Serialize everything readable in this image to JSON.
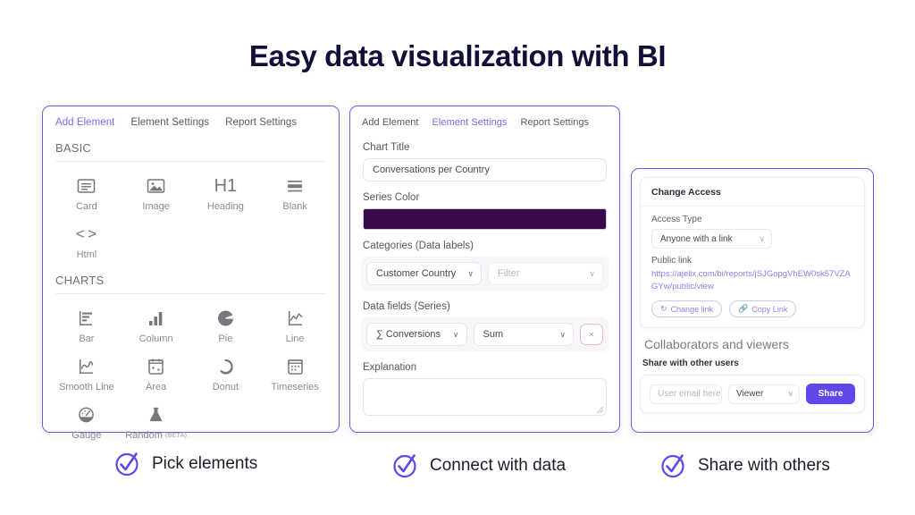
{
  "title": "Easy data visualization with BI",
  "theme": {
    "accent": "#6048e8",
    "panel_border": "#6c5ce0",
    "tab_active": "#7b68ee",
    "link": "#8b7fe8",
    "series_color": "#3a0a4a",
    "title_color": "#101138"
  },
  "panel_add_element": {
    "tabs": [
      {
        "label": "Add Element",
        "active": true
      },
      {
        "label": "Element Settings",
        "active": false
      },
      {
        "label": "Report Settings",
        "active": false
      }
    ],
    "sections": [
      {
        "heading": "BASIC",
        "items": [
          {
            "label": "Card",
            "icon": "card-icon"
          },
          {
            "label": "Image",
            "icon": "image-icon"
          },
          {
            "label": "Heading",
            "icon": "h1-icon"
          },
          {
            "label": "Blank",
            "icon": "blank-icon"
          },
          {
            "label": "Html",
            "icon": "code-icon"
          }
        ]
      },
      {
        "heading": "CHARTS",
        "items": [
          {
            "label": "Bar",
            "icon": "bar-chart-icon"
          },
          {
            "label": "Column",
            "icon": "column-chart-icon"
          },
          {
            "label": "Pie",
            "icon": "pie-chart-icon"
          },
          {
            "label": "Line",
            "icon": "line-chart-icon"
          },
          {
            "label": "Smooth Line",
            "icon": "smooth-line-chart-icon"
          },
          {
            "label": "Area",
            "icon": "area-chart-icon"
          },
          {
            "label": "Donut",
            "icon": "donut-chart-icon"
          },
          {
            "label": "Timeseries",
            "icon": "timeseries-chart-icon"
          },
          {
            "label": "Gauge",
            "icon": "gauge-chart-icon"
          },
          {
            "label": "Random",
            "badge": "(BETA)",
            "icon": "flask-icon"
          }
        ]
      }
    ]
  },
  "panel_element_settings": {
    "tabs": [
      {
        "label": "Add Element",
        "active": false
      },
      {
        "label": "Element Settings",
        "active": true
      },
      {
        "label": "Report Settings",
        "active": false
      }
    ],
    "chart_title": {
      "label": "Chart Title",
      "value": "Conversations per Country"
    },
    "series_color": {
      "label": "Series Color",
      "value": "#3a0a4a"
    },
    "categories": {
      "label": "Categories (Data labels)",
      "field_value": "Customer Country",
      "filter_placeholder": "Filter"
    },
    "data_fields": {
      "label": "Data fields (Series)",
      "series_value": "Conversions",
      "series_prefix": "∑",
      "aggregation_value": "Sum",
      "remove_label": "×"
    },
    "explanation": {
      "label": "Explanation",
      "value": ""
    }
  },
  "panel_share": {
    "change_access": {
      "card_title": "Change Access",
      "access_type_label": "Access Type",
      "access_type_value": "Anyone with a link",
      "public_link_label": "Public link",
      "public_link_url": "https://ajelix.com/bi/reports/jSJGopgVhEW0sk57VZAGYw/public/view",
      "change_link_button": "Change link",
      "copy_link_button": "Copy Link"
    },
    "collaborators": {
      "title": "Collaborators and viewers",
      "subtitle": "Share with other users",
      "email_placeholder": "User email here",
      "role_value": "Viewer",
      "share_button": "Share"
    }
  },
  "captions": [
    {
      "text": "Pick elements",
      "icon": "check-circle-icon"
    },
    {
      "text": "Connect with data",
      "icon": "check-circle-icon"
    },
    {
      "text": "Share with others",
      "icon": "check-circle-icon"
    }
  ]
}
